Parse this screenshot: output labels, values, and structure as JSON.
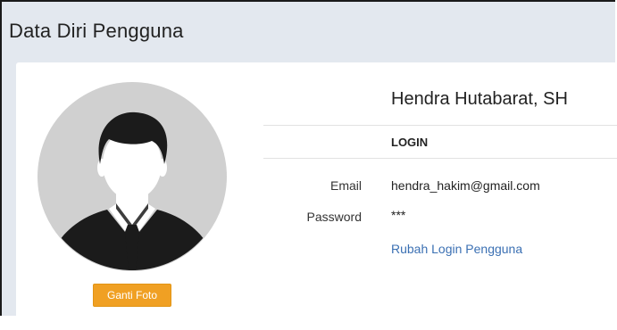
{
  "panel": {
    "title": "Data Diri Pengguna"
  },
  "profile": {
    "name": "Hendra Hutabarat, SH",
    "change_photo_label": "Ganti Foto",
    "avatar_icon": "user-avatar-icon"
  },
  "login": {
    "section_label": "LOGIN",
    "email_label": "Email",
    "email_value": "hendra_hakim@gmail.com",
    "password_label": "Password",
    "password_value": "***",
    "change_login_link": "Rubah Login Pengguna"
  },
  "colors": {
    "panel_bg": "#e3e8ef",
    "button_orange": "#f0a023",
    "link_blue": "#3b70b3"
  }
}
